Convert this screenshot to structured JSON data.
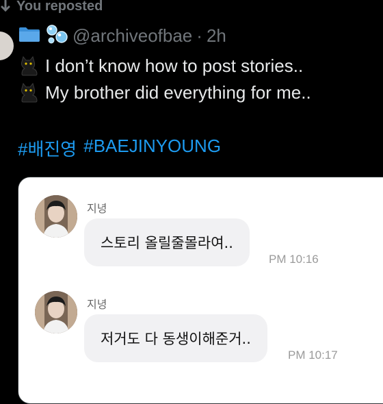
{
  "repost": {
    "label": "You reposted"
  },
  "post": {
    "handle": "@archiveofbae",
    "separator": "·",
    "time": "2h",
    "lines": [
      "I don’t know how to post stories..",
      "My brother did everything for me.."
    ],
    "hashtags": [
      "#배진영",
      "#BAEJINYOUNG"
    ]
  },
  "chat": {
    "messages": [
      {
        "sender": "지녕",
        "text": "스토리 올릴줄몰라여..",
        "time": "PM 10:16"
      },
      {
        "sender": "지녕",
        "text": "저거도 다 동생이해준거..",
        "time": "PM 10:17"
      }
    ]
  },
  "colors": {
    "background": "#000000",
    "muted": "#71767b",
    "text": "#e7e9ea",
    "link": "#1d9bf0",
    "card": "#ffffff",
    "bubble": "#f1f1f3"
  },
  "icons": [
    "repost-icon",
    "folder-icon",
    "bubbles-icon",
    "cat-icon"
  ]
}
